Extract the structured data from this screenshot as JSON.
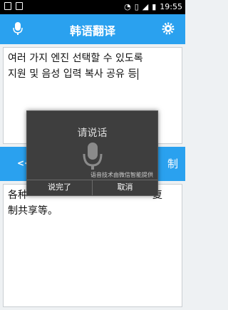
{
  "status_bar": {
    "time": "19:55"
  },
  "app_bar": {
    "title": "韩语翻译"
  },
  "input_panel": {
    "text_line1": "여러 가지 엔진 선택할 수 있도록",
    "text_line2": "지원 및 음성 입력 복사 공유 등"
  },
  "action_bar": {
    "left_label": "<<",
    "right_label": "制"
  },
  "output_panel": {
    "text_line1": "各种",
    "text_line1_tail": "复",
    "text_line2": "制共享等。"
  },
  "voice_dialog": {
    "title": "请说话",
    "credit": "语音技术由微信智能提供",
    "done_label": "说完了",
    "cancel_label": "取消"
  },
  "colors": {
    "accent": "#2aa1ef",
    "dialog_bg": "#3e3e3e"
  }
}
